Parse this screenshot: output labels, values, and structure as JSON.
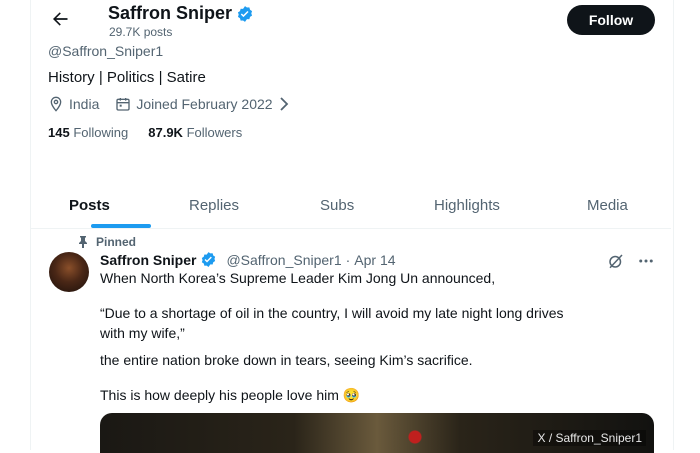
{
  "header": {
    "name": "Saffron Sniper",
    "post_count": "29.7K posts",
    "follow_label": "Follow"
  },
  "profile": {
    "handle": "@Saffron_Sniper1",
    "bio": "History | Politics | Satire",
    "location": "India",
    "joined": "Joined February 2022",
    "following_count": "145",
    "following_label": "Following",
    "followers_count": "87.9K",
    "followers_label": "Followers"
  },
  "tabs": [
    {
      "label": "Posts",
      "active": true
    },
    {
      "label": "Replies",
      "active": false
    },
    {
      "label": "Subs",
      "active": false
    },
    {
      "label": "Highlights",
      "active": false
    },
    {
      "label": "Media",
      "active": false
    }
  ],
  "post": {
    "pinned_label": "Pinned",
    "author_name": "Saffron Sniper",
    "author_handle": "@Saffron_Sniper1",
    "separator": "·",
    "date": "Apr 14",
    "lines": [
      "When North Korea’s Supreme Leader Kim Jong Un announced,",
      "“Due to a shortage of oil in the country, I will avoid my late night long drives",
      "with my wife,”",
      "the entire nation broke down in tears, seeing Kim’s sacrifice.",
      "This is how deeply his people love him 🥹"
    ],
    "media_watermark": "X / Saffron_Sniper1"
  },
  "colors": {
    "accent": "#1d9bf0",
    "text": "#0f1419",
    "secondary": "#536471",
    "follow_bg": "#0f1419"
  },
  "icons": {
    "back": "arrow-left-icon",
    "verified": "verified-badge-icon",
    "location": "location-pin-icon",
    "calendar": "calendar-icon",
    "pin": "pin-icon",
    "grok": "grok-icon",
    "more": "more-icon"
  }
}
